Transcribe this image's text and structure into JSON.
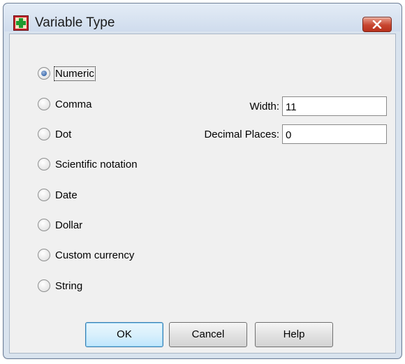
{
  "window": {
    "title": "Variable Type",
    "app_icon": "spss-variable-grid-icon",
    "close_icon": "close-icon"
  },
  "type_options": [
    {
      "label": "Numeric",
      "checked": true
    },
    {
      "label": "Comma",
      "checked": false
    },
    {
      "label": "Dot",
      "checked": false
    },
    {
      "label": "Scientific notation",
      "checked": false
    },
    {
      "label": "Date",
      "checked": false
    },
    {
      "label": "Dollar",
      "checked": false
    },
    {
      "label": "Custom currency",
      "checked": false
    },
    {
      "label": "String",
      "checked": false
    }
  ],
  "fields": {
    "width_label": "Width:",
    "width_value": "11",
    "decimals_label": "Decimal Places:",
    "decimals_value": "0"
  },
  "buttons": {
    "ok": "OK",
    "cancel": "Cancel",
    "help": "Help"
  },
  "colors": {
    "close_button": "#c7452f",
    "default_button_border": "#3c7fb1",
    "radio_selected": "#3f6fb0"
  }
}
